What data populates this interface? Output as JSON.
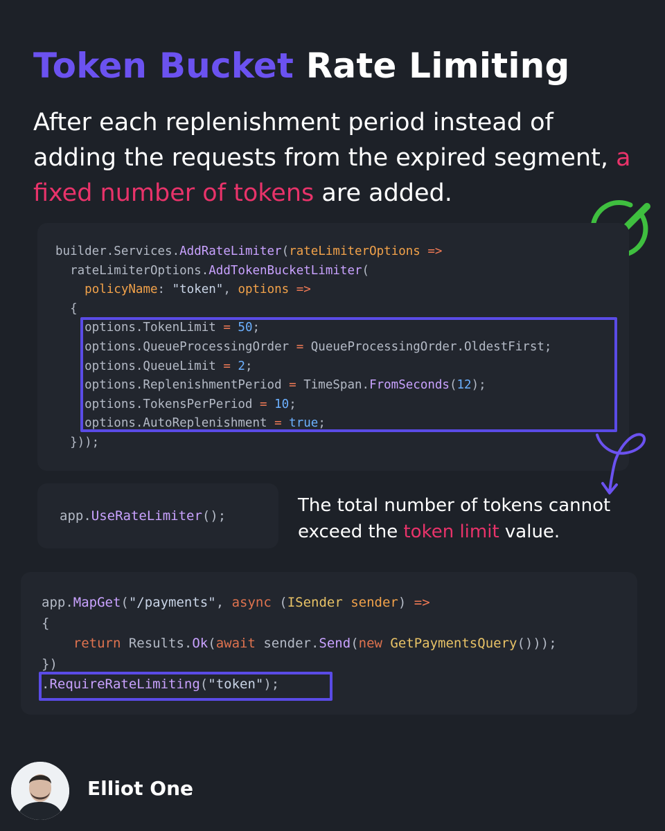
{
  "header": {
    "title_accent": "Token Bucket",
    "title_rest": "Rate Limiting"
  },
  "intro": {
    "text_before": "After each replenishment period instead of adding the requests from the expired segment, ",
    "highlight": "a fixed number of tokens",
    "text_after": " are added."
  },
  "code_config": {
    "l1_a": "builder.Services.",
    "l1_fn": "AddRateLimiter",
    "l1_b": "(",
    "l1_param": "rateLimiterOptions",
    "l1_op": " =>",
    "l2_a": "  rateLimiterOptions.",
    "l2_fn": "AddTokenBucketLimiter",
    "l2_b": "(",
    "l3_a": "    ",
    "l3_param": "policyName",
    "l3_b": ": ",
    "l3_str": "\"token\"",
    "l3_c": ", ",
    "l3_param2": "options",
    "l3_op": " =>",
    "l4": "  {",
    "l5_a": "    options.TokenLimit ",
    "l5_op": "=",
    "l5_b": " ",
    "l5_num": "50",
    "l5_c": ";",
    "l6_a": "    options.QueueProcessingOrder ",
    "l6_op": "=",
    "l6_b": " QueueProcessingOrder.OldestFirst;",
    "l7_a": "    options.QueueLimit ",
    "l7_op": "=",
    "l7_b": " ",
    "l7_num": "2",
    "l7_c": ";",
    "l8_a": "    options.ReplenishmentPeriod ",
    "l8_op": "=",
    "l8_b": " TimeSpan.",
    "l8_fn": "FromSeconds",
    "l8_c": "(",
    "l8_num": "12",
    "l8_d": ");",
    "l9_a": "    options.TokensPerPeriod ",
    "l9_op": "=",
    "l9_b": " ",
    "l9_num": "10",
    "l9_c": ";",
    "l10_a": "    options.AutoReplenishment ",
    "l10_op": "=",
    "l10_b": " ",
    "l10_num": "true",
    "l10_c": ";",
    "l11": "  }));"
  },
  "code_use": {
    "a": "app.",
    "fn": "UseRateLimiter",
    "b": "();"
  },
  "note": {
    "text_before": "The total number of tokens cannot exceed the ",
    "highlight": "token limit",
    "text_after": " value."
  },
  "code_map": {
    "l1_a": "app.",
    "l1_fn": "MapGet",
    "l1_b": "(",
    "l1_str": "\"/payments\"",
    "l1_c": ", ",
    "l1_kw": "async",
    "l1_d": " (",
    "l1_type": "ISender",
    "l1_e": " ",
    "l1_param": "sender",
    "l1_f": ")",
    "l1_op": " =>",
    "l2": "{",
    "l3_a": "    ",
    "l3_kw": "return",
    "l3_b": " Results.",
    "l3_fn": "Ok",
    "l3_c": "(",
    "l3_kw2": "await",
    "l3_d": " sender.",
    "l3_fn2": "Send",
    "l3_e": "(",
    "l3_kw3": "new",
    "l3_f": " ",
    "l3_type": "GetPaymentsQuery",
    "l3_g": "()));",
    "l4": "})",
    "l5_a": ".",
    "l5_fn": "RequireRateLimiting",
    "l5_b": "(",
    "l5_str": "\"token\"",
    "l5_c": ");"
  },
  "author": {
    "name": "Elliot One"
  },
  "icons": {
    "check": "check-circle-icon",
    "arrow": "curly-arrow-icon",
    "avatar": "avatar"
  },
  "colors": {
    "accent": "#6b52f0",
    "highlight_pink": "#e8336a",
    "check_green": "#3fbf3f",
    "background": "#1d2128"
  }
}
